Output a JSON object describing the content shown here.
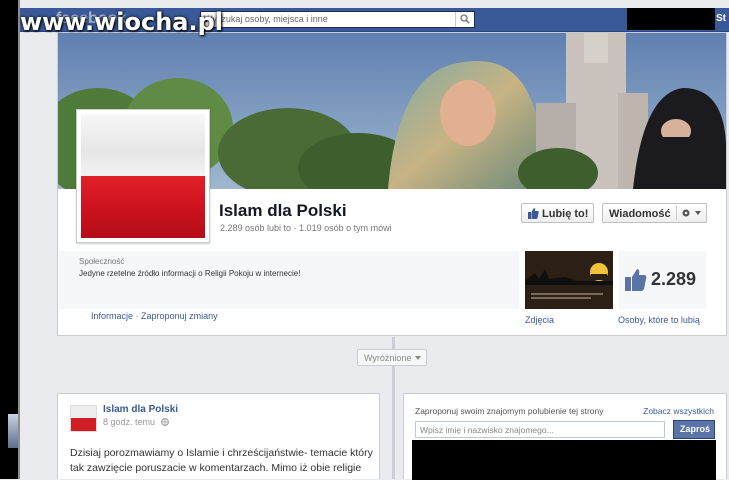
{
  "watermark": "www.wiocha.pl",
  "topbar": {
    "logo": "facebook",
    "search_placeholder": "Wyszukaj osoby, miejsca i inne",
    "right_text": "St"
  },
  "page": {
    "name": "Islam dla Polski",
    "stats": "2.289 osób lubi to · 1.019 osób o tym mówi",
    "like_button": "Lubię to!",
    "message_button": "Wiadomość",
    "category": "Społeczność",
    "about": "Jedyne rzetelne źródło informacji o Religii Pokoju w internecie!",
    "links": [
      "Informacje",
      "Zaproponuj zmiany"
    ],
    "photos_label": "Zdjęcia",
    "likes_count": "2.289",
    "likes_label": "Osoby, które to lubią"
  },
  "timeline": {
    "filter": "Wyróżnione"
  },
  "post": {
    "author": "Islam dla Polski",
    "time": "8 godz. temu",
    "text": "Dzisiaj porozmawiamy o Islamie i chrześcijaństwie- temacie który tak zawzięcie poruszacie w komentarzach. Mimo iż obie religie"
  },
  "invite": {
    "title": "Zaproponuj swoim znajomym polubienie tej strony",
    "see_all": "Zobacz wszystkich",
    "placeholder": "Wpisz imię i nazwisko znajomego...",
    "button": "Zaproś"
  },
  "colors": {
    "brand": "#3b5998",
    "flag_red": "#d01c24",
    "background": "#e9ebee"
  }
}
